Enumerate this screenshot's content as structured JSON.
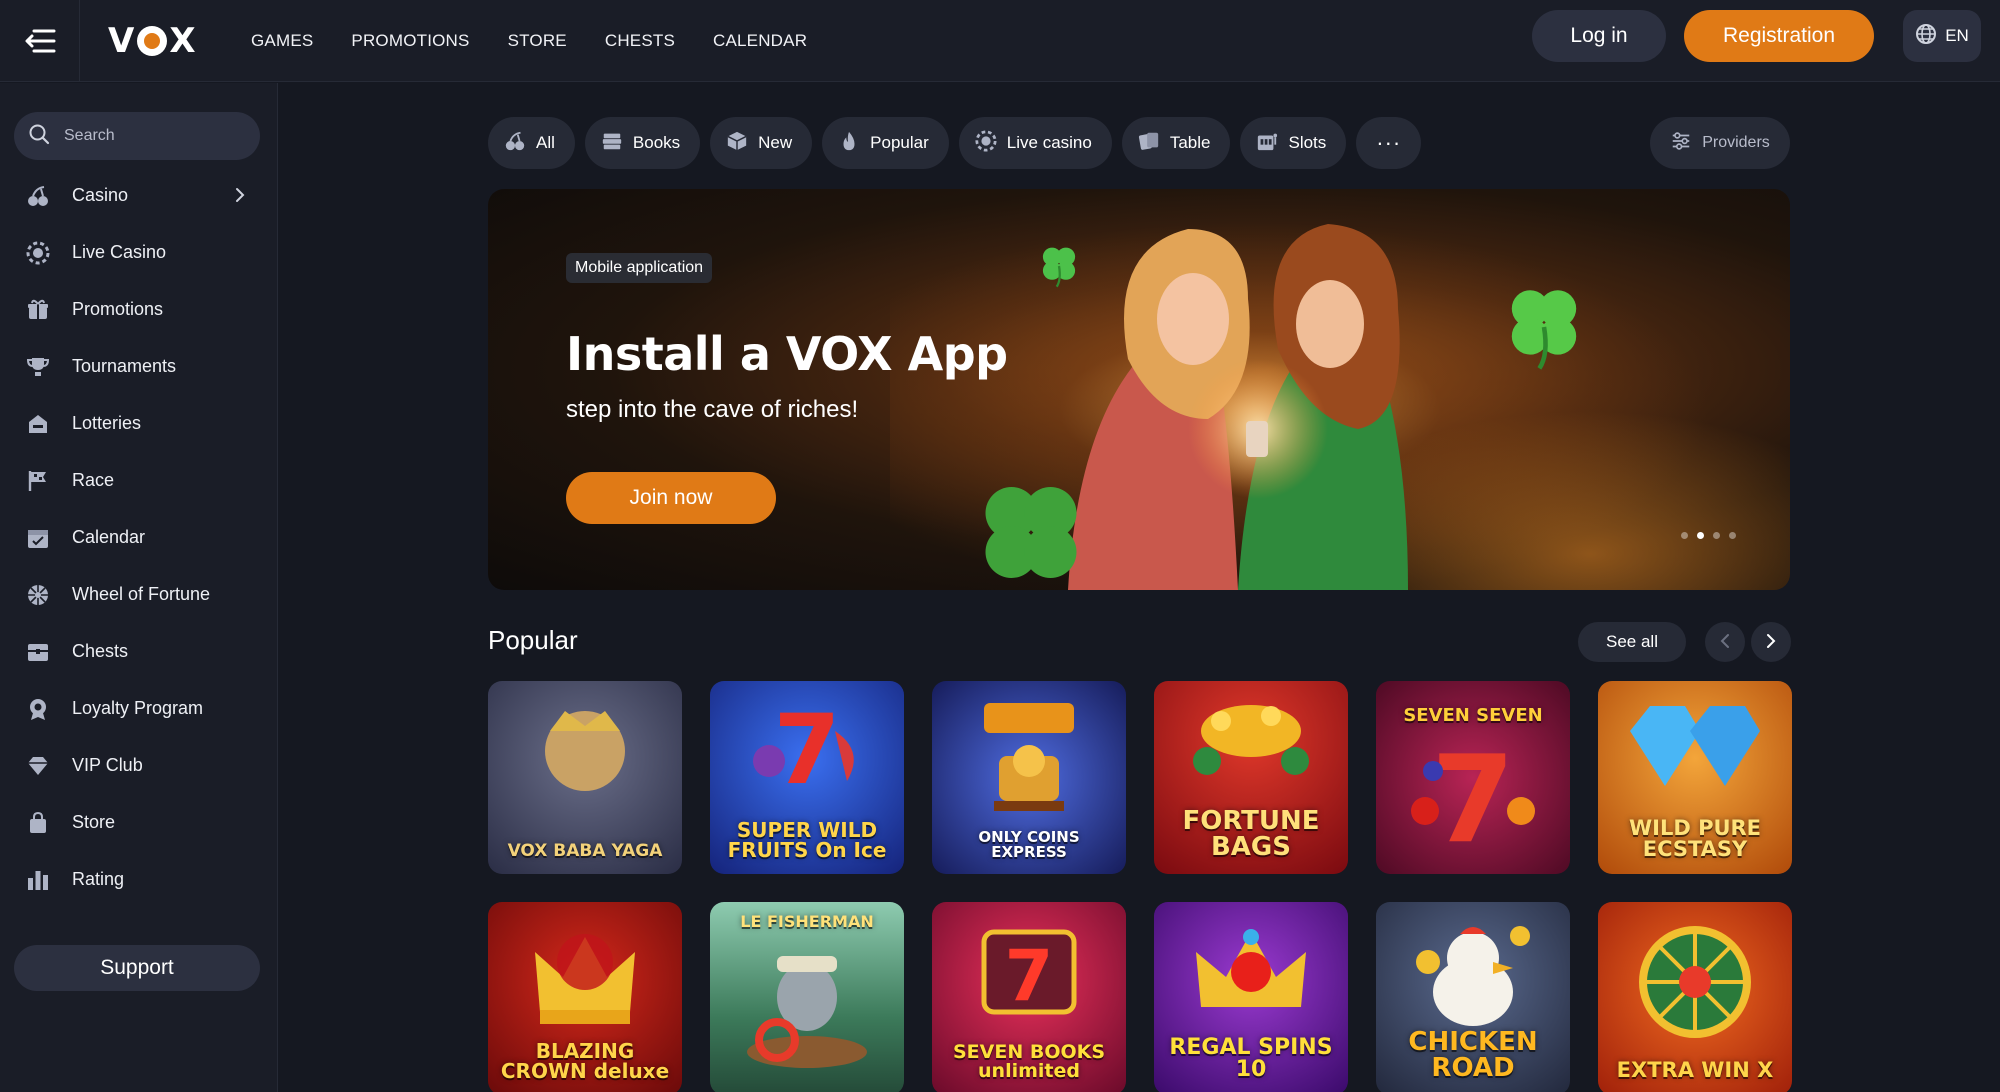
{
  "header": {
    "logo": "VOX",
    "nav": [
      "GAMES",
      "PROMOTIONS",
      "STORE",
      "CHESTS",
      "CALENDAR"
    ],
    "login_label": "Log in",
    "register_label": "Registration",
    "language": "EN"
  },
  "sidebar": {
    "search_placeholder": "Search",
    "items": [
      {
        "label": "Casino",
        "icon": "cherries-icon"
      },
      {
        "label": "Live Casino",
        "icon": "chip-icon"
      },
      {
        "label": "Promotions",
        "icon": "gift-icon"
      },
      {
        "label": "Tournaments",
        "icon": "trophy-icon"
      },
      {
        "label": "Lotteries",
        "icon": "lottery-icon"
      },
      {
        "label": "Race",
        "icon": "flag-icon"
      },
      {
        "label": "Calendar",
        "icon": "calendar-icon"
      },
      {
        "label": "Wheel of Fortune",
        "icon": "wheel-icon"
      },
      {
        "label": "Chests",
        "icon": "chest-icon"
      },
      {
        "label": "Loyalty Program",
        "icon": "medal-icon"
      },
      {
        "label": "VIP Club",
        "icon": "diamond-icon"
      },
      {
        "label": "Store",
        "icon": "bag-icon"
      },
      {
        "label": "Rating",
        "icon": "bar-chart-icon"
      }
    ],
    "support_label": "Support"
  },
  "categories": {
    "chips": [
      "All",
      "Books",
      "New",
      "Popular",
      "Live casino",
      "Table",
      "Slots"
    ],
    "more": "···",
    "providers_label": "Providers"
  },
  "banner": {
    "badge": "Mobile application",
    "title": "Install a VOX App",
    "subtitle": "step into the cave of riches!",
    "cta": "Join now",
    "slides": 4,
    "active_slide": 2
  },
  "popular": {
    "title": "Popular",
    "see_all": "See all",
    "games": [
      {
        "title": "VOX BABA YAGA",
        "bg": "#3b3f5c"
      },
      {
        "title": "SUPER WILD FRUITS On Ice",
        "bg": "#1d3aa8"
      },
      {
        "title": "ONLY COINS EXPRESS",
        "bg": "#2a3b8f"
      },
      {
        "title": "FORTUNE BAGS",
        "bg": "#b8141c"
      },
      {
        "title": "SEVEN SEVEN",
        "bg": "#8a1240"
      },
      {
        "title": "WILD PURE ECSTASY",
        "bg": "#e07a16"
      },
      {
        "title": "BLAZING CROWN deluxe",
        "bg": "#b01818"
      },
      {
        "title": "LE FISHERMAN",
        "bg": "#4f8a6a"
      },
      {
        "title": "SEVEN BOOKS unlimited",
        "bg": "#c2183a"
      },
      {
        "title": "REGAL SPINS 10",
        "bg": "#6a1ca0"
      },
      {
        "title": "CHICKEN ROAD",
        "bg": "#3c4a66"
      },
      {
        "title": "EXTRA WIN X",
        "bg": "#d0481a"
      }
    ]
  },
  "colors": {
    "accent": "#e07a16",
    "background": "#151821",
    "panel": "#1a1d27",
    "chip": "#262a36"
  }
}
